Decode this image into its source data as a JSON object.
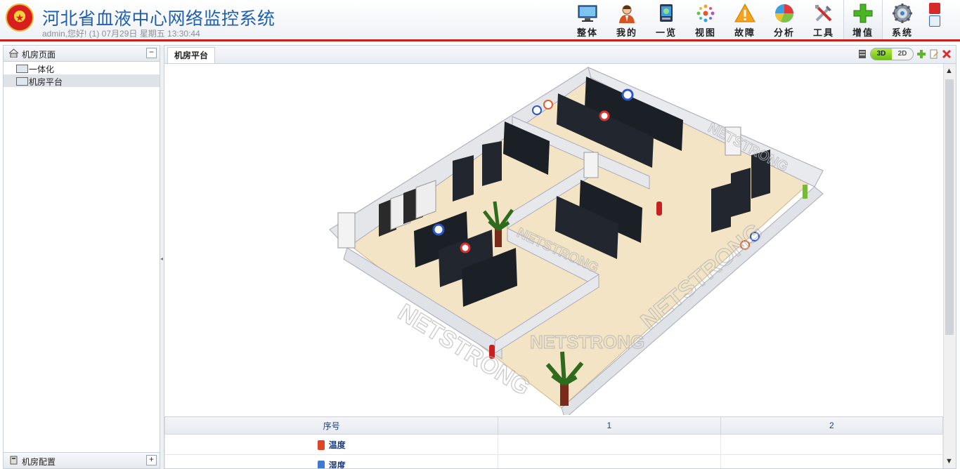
{
  "header": {
    "title": "河北省血液中心网络监控系统",
    "subtitle": "admin,您好! (1) 07月29日 星期五 13:30:44",
    "nav": [
      {
        "label": "整体",
        "icon": "monitor-icon"
      },
      {
        "label": "我的",
        "icon": "user-icon"
      },
      {
        "label": "一览",
        "icon": "overview-icon"
      },
      {
        "label": "视图",
        "icon": "dots-icon"
      },
      {
        "label": "故障",
        "icon": "warning-icon"
      },
      {
        "label": "分析",
        "icon": "pie-chart-icon"
      },
      {
        "label": "工具",
        "icon": "tools-icon"
      },
      {
        "label": "增值",
        "icon": "plus-icon"
      },
      {
        "label": "系统",
        "icon": "gear-icon"
      }
    ],
    "active_nav": "增值"
  },
  "left_panel": {
    "title": "机房页面",
    "collapse": "−",
    "items": [
      {
        "label": "一体化"
      },
      {
        "label": "机房平台"
      }
    ],
    "selected": "机房平台",
    "footer": "机房配置",
    "footer_toggle": "+"
  },
  "tab": {
    "label": "机房平台"
  },
  "view_toggle": {
    "three_d": "3D",
    "two_d": "2D",
    "active": "3D"
  },
  "scene": {
    "watermark": "NETSTRONG"
  },
  "table": {
    "headers": [
      "序号",
      "1",
      "2"
    ],
    "rows": [
      {
        "label": "温度",
        "icon": "thermometer-icon",
        "values": [
          "",
          ""
        ]
      },
      {
        "label": "湿度",
        "icon": "humidity-icon",
        "values": [
          "",
          ""
        ]
      }
    ]
  },
  "colors": {
    "accent": "#c8201c",
    "title": "#1f5fb0",
    "floor": "#f2e4c4",
    "wall": "#e4e6ea",
    "rack": "#1b1f26",
    "toggle_on": "#7ccb1a"
  }
}
